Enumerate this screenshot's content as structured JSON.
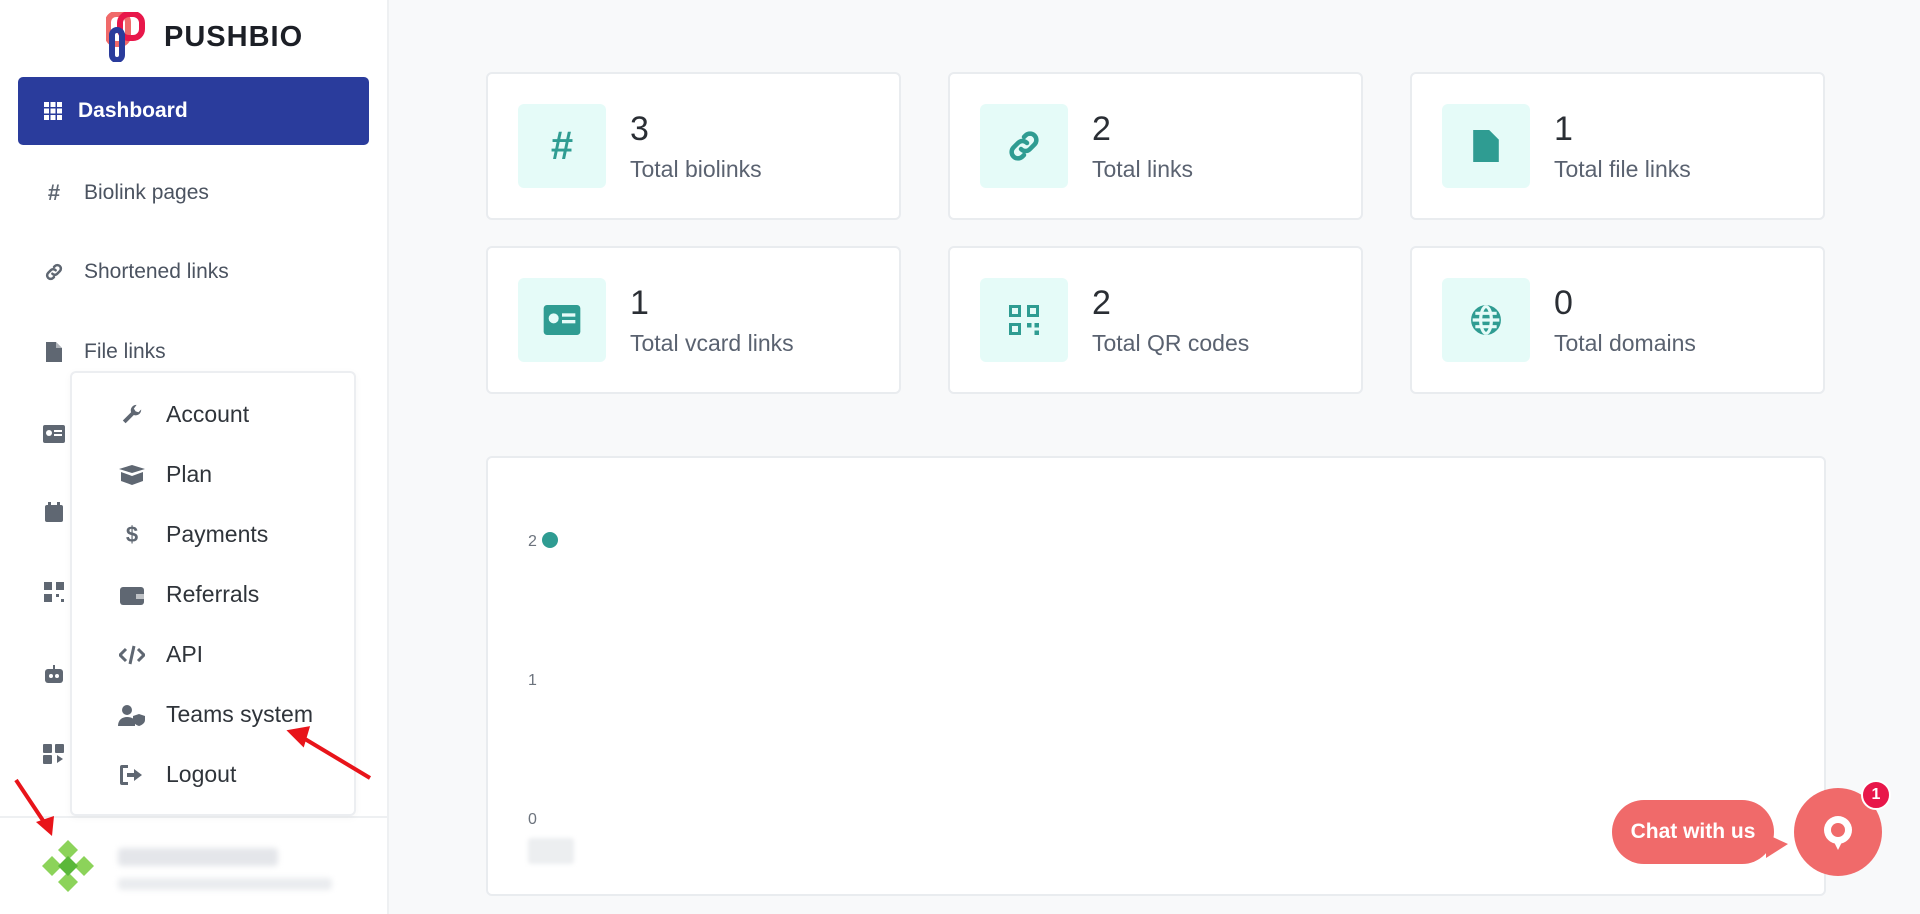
{
  "brand": {
    "name": "PUSHBIO"
  },
  "sidebar": {
    "active": {
      "label": "Dashboard"
    },
    "items": [
      {
        "label": "Biolink pages"
      },
      {
        "label": "Shortened links"
      },
      {
        "label": "File links"
      }
    ]
  },
  "menu": {
    "items": [
      {
        "label": "Account"
      },
      {
        "label": "Plan"
      },
      {
        "label": "Payments"
      },
      {
        "label": "Referrals"
      },
      {
        "label": "API"
      },
      {
        "label": "Teams system"
      },
      {
        "label": "Logout"
      }
    ]
  },
  "stats": [
    {
      "value": "3",
      "label": "Total biolinks"
    },
    {
      "value": "2",
      "label": "Total links"
    },
    {
      "value": "1",
      "label": "Total file links"
    },
    {
      "value": "1",
      "label": "Total vcard links"
    },
    {
      "value": "2",
      "label": "Total QR codes"
    },
    {
      "value": "0",
      "label": "Total domains"
    }
  ],
  "chart_data": {
    "type": "line",
    "title": "",
    "xlabel": "",
    "ylabel": "",
    "ylim": [
      0,
      2
    ],
    "yticks": [
      "2",
      "1",
      "0"
    ],
    "series": [
      {
        "values": [
          2
        ]
      }
    ]
  },
  "chat": {
    "label": "Chat with us",
    "badge": "1"
  },
  "colors": {
    "primary": "#2a3c9c",
    "accent": "#2f9c92",
    "chat": "#f06a6a",
    "badge": "#e8174a"
  }
}
